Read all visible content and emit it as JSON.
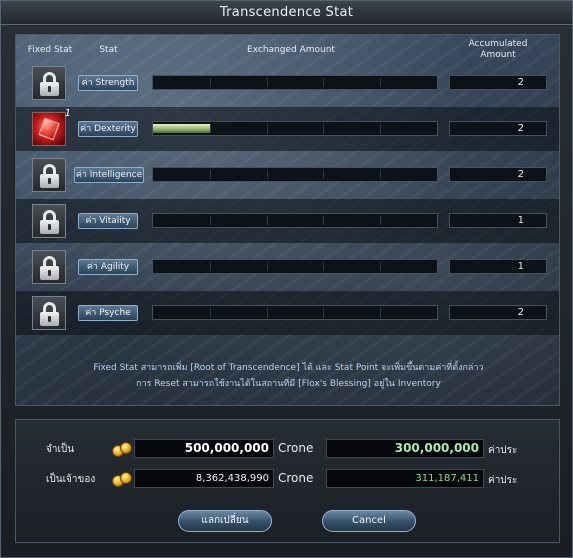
{
  "window": {
    "title": "Transcendence Stat"
  },
  "headers": {
    "fixed_stat": "Fixed Stat",
    "stat": "Stat",
    "exchanged": "Exchanged Amount",
    "accumulated_1": "Accumulated",
    "accumulated_2": "Amount"
  },
  "stats": [
    {
      "label": "ค่า Strength",
      "fixed": "lock-icon",
      "progress": 0,
      "accumulated": "2"
    },
    {
      "label": "ค่า Dexterity",
      "fixed": "gem-icon",
      "gem_count": "1",
      "progress": 0.2,
      "accumulated": "2"
    },
    {
      "label": "ค่า Intelligence",
      "fixed": "lock-icon",
      "progress": 0,
      "accumulated": "2"
    },
    {
      "label": "ค่า Vitality",
      "fixed": "lock-icon",
      "progress": 0,
      "accumulated": "1"
    },
    {
      "label": "ค่า Agility",
      "fixed": "lock-icon",
      "progress": 0,
      "accumulated": "1"
    },
    {
      "label": "ค่า Psyche",
      "fixed": "lock-icon",
      "progress": 0,
      "accumulated": "2"
    }
  ],
  "info": {
    "line1": "Fixed Stat สามารถเพิ่ม [Root of Transcendence] ได้ และ Stat Point จะเพิ่มขึ้นตามค่าที่ตั้งกล่าว",
    "line2": "การ Reset สามารถใช้งานได้ในสถานที่มี [Flox's Blessing] อยู่ใน Inventory"
  },
  "cost": {
    "required_label": "จำเป็น",
    "required_amount": "500,000,000",
    "required_unit": "Crone",
    "required_points": "300,000,000",
    "points_unit": "ค่าประ",
    "owned_label": "เป็นเจ้าของ",
    "owned_amount": "8,362,438,990",
    "owned_unit": "Crone",
    "owned_points": "311,187,411",
    "owned_points_unit": "ค่าประ"
  },
  "buttons": {
    "exchange": "แลกเปลี่ยน",
    "cancel": "Cancel"
  },
  "colors": {
    "points_required": "#a6ecb0",
    "points_owned": "#8fd99a",
    "bar_fill": "#b8d596"
  }
}
